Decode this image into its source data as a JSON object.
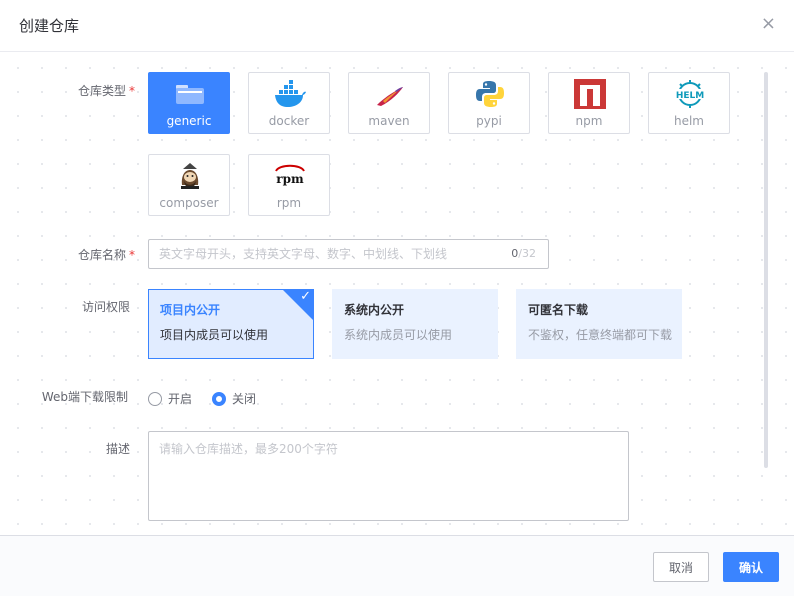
{
  "dialog": {
    "title": "创建仓库",
    "close_glyph": "×"
  },
  "form": {
    "repo_type_label": "仓库类型",
    "repo_name_label": "仓库名称",
    "access_label": "访问权限",
    "web_download_label": "Web端下载限制",
    "desc_label": "描述",
    "required_mark": "*"
  },
  "repo_types": [
    {
      "label": "generic",
      "icon": "generic-icon",
      "selected": true
    },
    {
      "label": "docker",
      "icon": "docker-icon",
      "selected": false
    },
    {
      "label": "maven",
      "icon": "maven-icon",
      "selected": false
    },
    {
      "label": "pypi",
      "icon": "pypi-icon",
      "selected": false
    },
    {
      "label": "npm",
      "icon": "npm-icon",
      "selected": false
    },
    {
      "label": "helm",
      "icon": "helm-icon",
      "selected": false
    },
    {
      "label": "composer",
      "icon": "composer-icon",
      "selected": false
    },
    {
      "label": "rpm",
      "icon": "rpm-icon",
      "selected": false
    }
  ],
  "name_input": {
    "value": "",
    "placeholder": "英文字母开头，支持英文字母、数字、中划线、下划线",
    "count": "0",
    "max": "/32"
  },
  "access_options": [
    {
      "title": "项目内公开",
      "desc": "项目内成员可以使用",
      "selected": true
    },
    {
      "title": "系统内公开",
      "desc": "系统内成员可以使用",
      "selected": false
    },
    {
      "title": "可匿名下载",
      "desc": "不鉴权，任意终端都可下载",
      "selected": false
    }
  ],
  "web_download": {
    "on_label": "开启",
    "off_label": "关闭",
    "selected": "off"
  },
  "description": {
    "value": "",
    "placeholder": "请输入仓库描述，最多200个字符"
  },
  "footer": {
    "cancel_label": "取消",
    "confirm_label": "确认"
  },
  "colors": {
    "primary": "#3a84ff",
    "required": "#ea3636",
    "npm_red": "#cb3837",
    "docker_blue": "#2496ed",
    "helm_teal": "#0f9aba"
  }
}
